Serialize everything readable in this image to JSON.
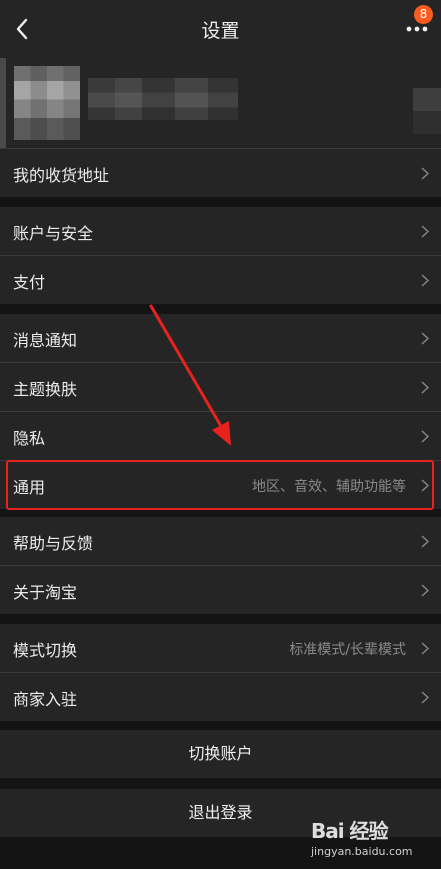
{
  "header": {
    "title": "设置",
    "badge_count": "8"
  },
  "address": {
    "label": "我的收货地址"
  },
  "group1": [
    {
      "label": "账户与安全"
    },
    {
      "label": "支付"
    }
  ],
  "group2": [
    {
      "label": "消息通知"
    },
    {
      "label": "主题换肤"
    },
    {
      "label": "隐私"
    },
    {
      "label": "通用",
      "sub": "地区、音效、辅助功能等"
    }
  ],
  "group3": [
    {
      "label": "帮助与反馈"
    },
    {
      "label": "关于淘宝"
    }
  ],
  "group4": [
    {
      "label": "模式切换",
      "sub": "标准模式/长辈模式"
    },
    {
      "label": "商家入驻"
    }
  ],
  "actions": {
    "switch_account": "切换账户",
    "logout": "退出登录"
  },
  "watermark": {
    "logo": "Bai 经验",
    "url": "jingyan.baidu.com"
  },
  "colors": {
    "highlight": "#e8231f",
    "badge": "#ff5a1f"
  }
}
